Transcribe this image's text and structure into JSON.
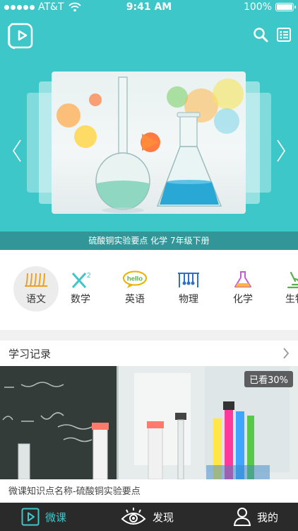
{
  "status_bar": {
    "carrier": "AT&T",
    "time": "9:41 AM",
    "battery": "100%",
    "battery_level": 1.0
  },
  "header": {
    "logo_icon": "play-book-icon",
    "search_icon": "search-icon",
    "list_icon": "list-icon"
  },
  "banner": {
    "caption": "硫酸铜实验要点  化学 7年级下册"
  },
  "subjects": [
    {
      "label": "语文",
      "icon": "wheat-icon",
      "color": "#f0a020",
      "active": true
    },
    {
      "label": "数学",
      "icon": "x-squared-icon",
      "color": "#3ec7c9",
      "active": false
    },
    {
      "label": "英语",
      "icon": "hello-bubble-icon",
      "color": "#e9b100",
      "active": false
    },
    {
      "label": "物理",
      "icon": "pendulum-icon",
      "color": "#2f6fc8",
      "active": false
    },
    {
      "label": "化学",
      "icon": "flask-icon",
      "color": "#c15fd0",
      "active": false
    },
    {
      "label": "生物",
      "icon": "microscope-icon",
      "color": "#58b04a",
      "active": false
    }
  ],
  "record_section": {
    "title": "学习记录"
  },
  "record": {
    "badge": "已看30%",
    "progress_percent": 30,
    "title": "微课知识点名称-硫酸铜实验要点"
  },
  "tabbar": [
    {
      "label": "微课",
      "icon": "play-icon",
      "active": true
    },
    {
      "label": "发现",
      "icon": "eye-icon",
      "active": false
    },
    {
      "label": "我的",
      "icon": "user-icon",
      "active": false
    }
  ],
  "colors": {
    "accent": "#3ec7c9",
    "tabbar_bg": "#2a2a2a"
  }
}
